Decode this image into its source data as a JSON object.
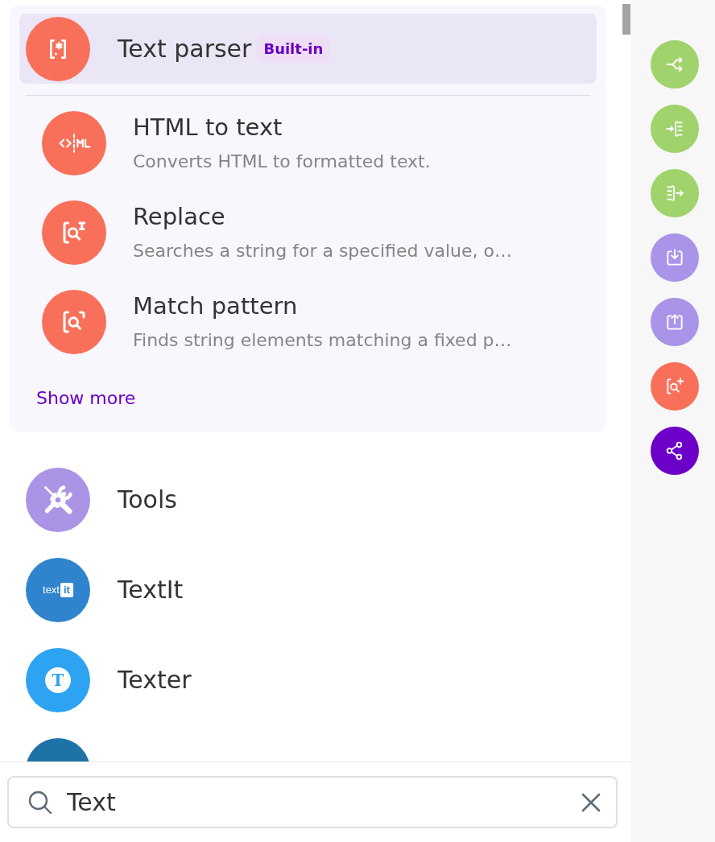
{
  "group": {
    "header": {
      "title": "Text parser",
      "badge": "Built-in",
      "selected": true
    },
    "items": [
      {
        "kind": "html",
        "title": "HTML to text",
        "description": "Converts HTML to formatted text."
      },
      {
        "kind": "replace",
        "title": "Replace",
        "description": "Searches a string for a specified value, o…"
      },
      {
        "kind": "match",
        "title": "Match pattern",
        "description": "Finds string elements matching a fixed p…"
      }
    ],
    "show_more": "Show more"
  },
  "results": [
    {
      "kind": "tools",
      "title": "Tools"
    },
    {
      "kind": "textit",
      "title": "TextIt",
      "logo_text": [
        "text",
        "it"
      ]
    },
    {
      "kind": "texter",
      "title": "Texter",
      "logo_text": [
        "T"
      ]
    },
    {
      "kind": "partial"
    }
  ],
  "search": {
    "value": "Text"
  },
  "sidebar": {
    "buttons": [
      {
        "kind": "split"
      },
      {
        "kind": "inbound"
      },
      {
        "kind": "outbound"
      },
      {
        "kind": "download"
      },
      {
        "kind": "upload"
      },
      {
        "kind": "search"
      },
      {
        "kind": "share"
      }
    ]
  }
}
